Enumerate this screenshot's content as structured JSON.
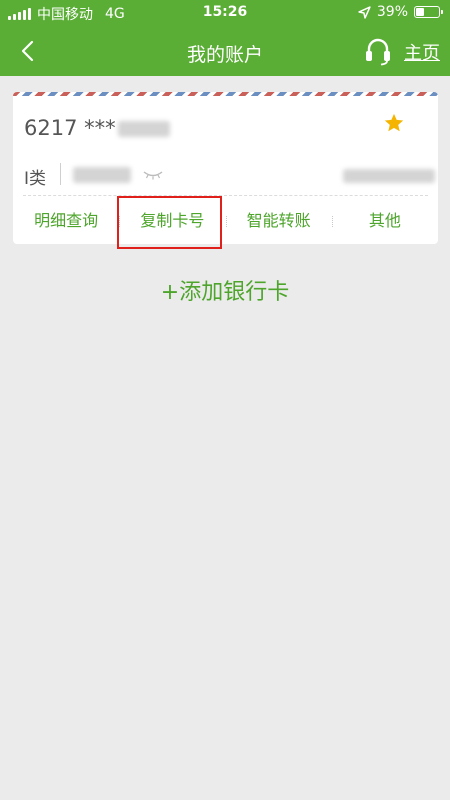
{
  "status_bar": {
    "carrier": "中国移动",
    "network": "4G",
    "time": "15:26",
    "battery": "39%",
    "battery_level": 0.39
  },
  "nav": {
    "title": "我的账户",
    "home_label": "主页",
    "color": "#5aad35"
  },
  "card": {
    "number_prefix": "6217 ***",
    "type": "I类",
    "favorite_icon": "star-icon",
    "visibility_icon": "eye-closed-icon",
    "actions": [
      "明细查询",
      "复制卡号",
      "智能转账",
      "其他"
    ]
  },
  "add_card_label": "+添加银行卡",
  "colors": {
    "accent": "#5aad35",
    "action_text": "#4ea52c",
    "star": "#f5b400",
    "highlight_box": "#e0201b",
    "background": "#ebebeb"
  }
}
